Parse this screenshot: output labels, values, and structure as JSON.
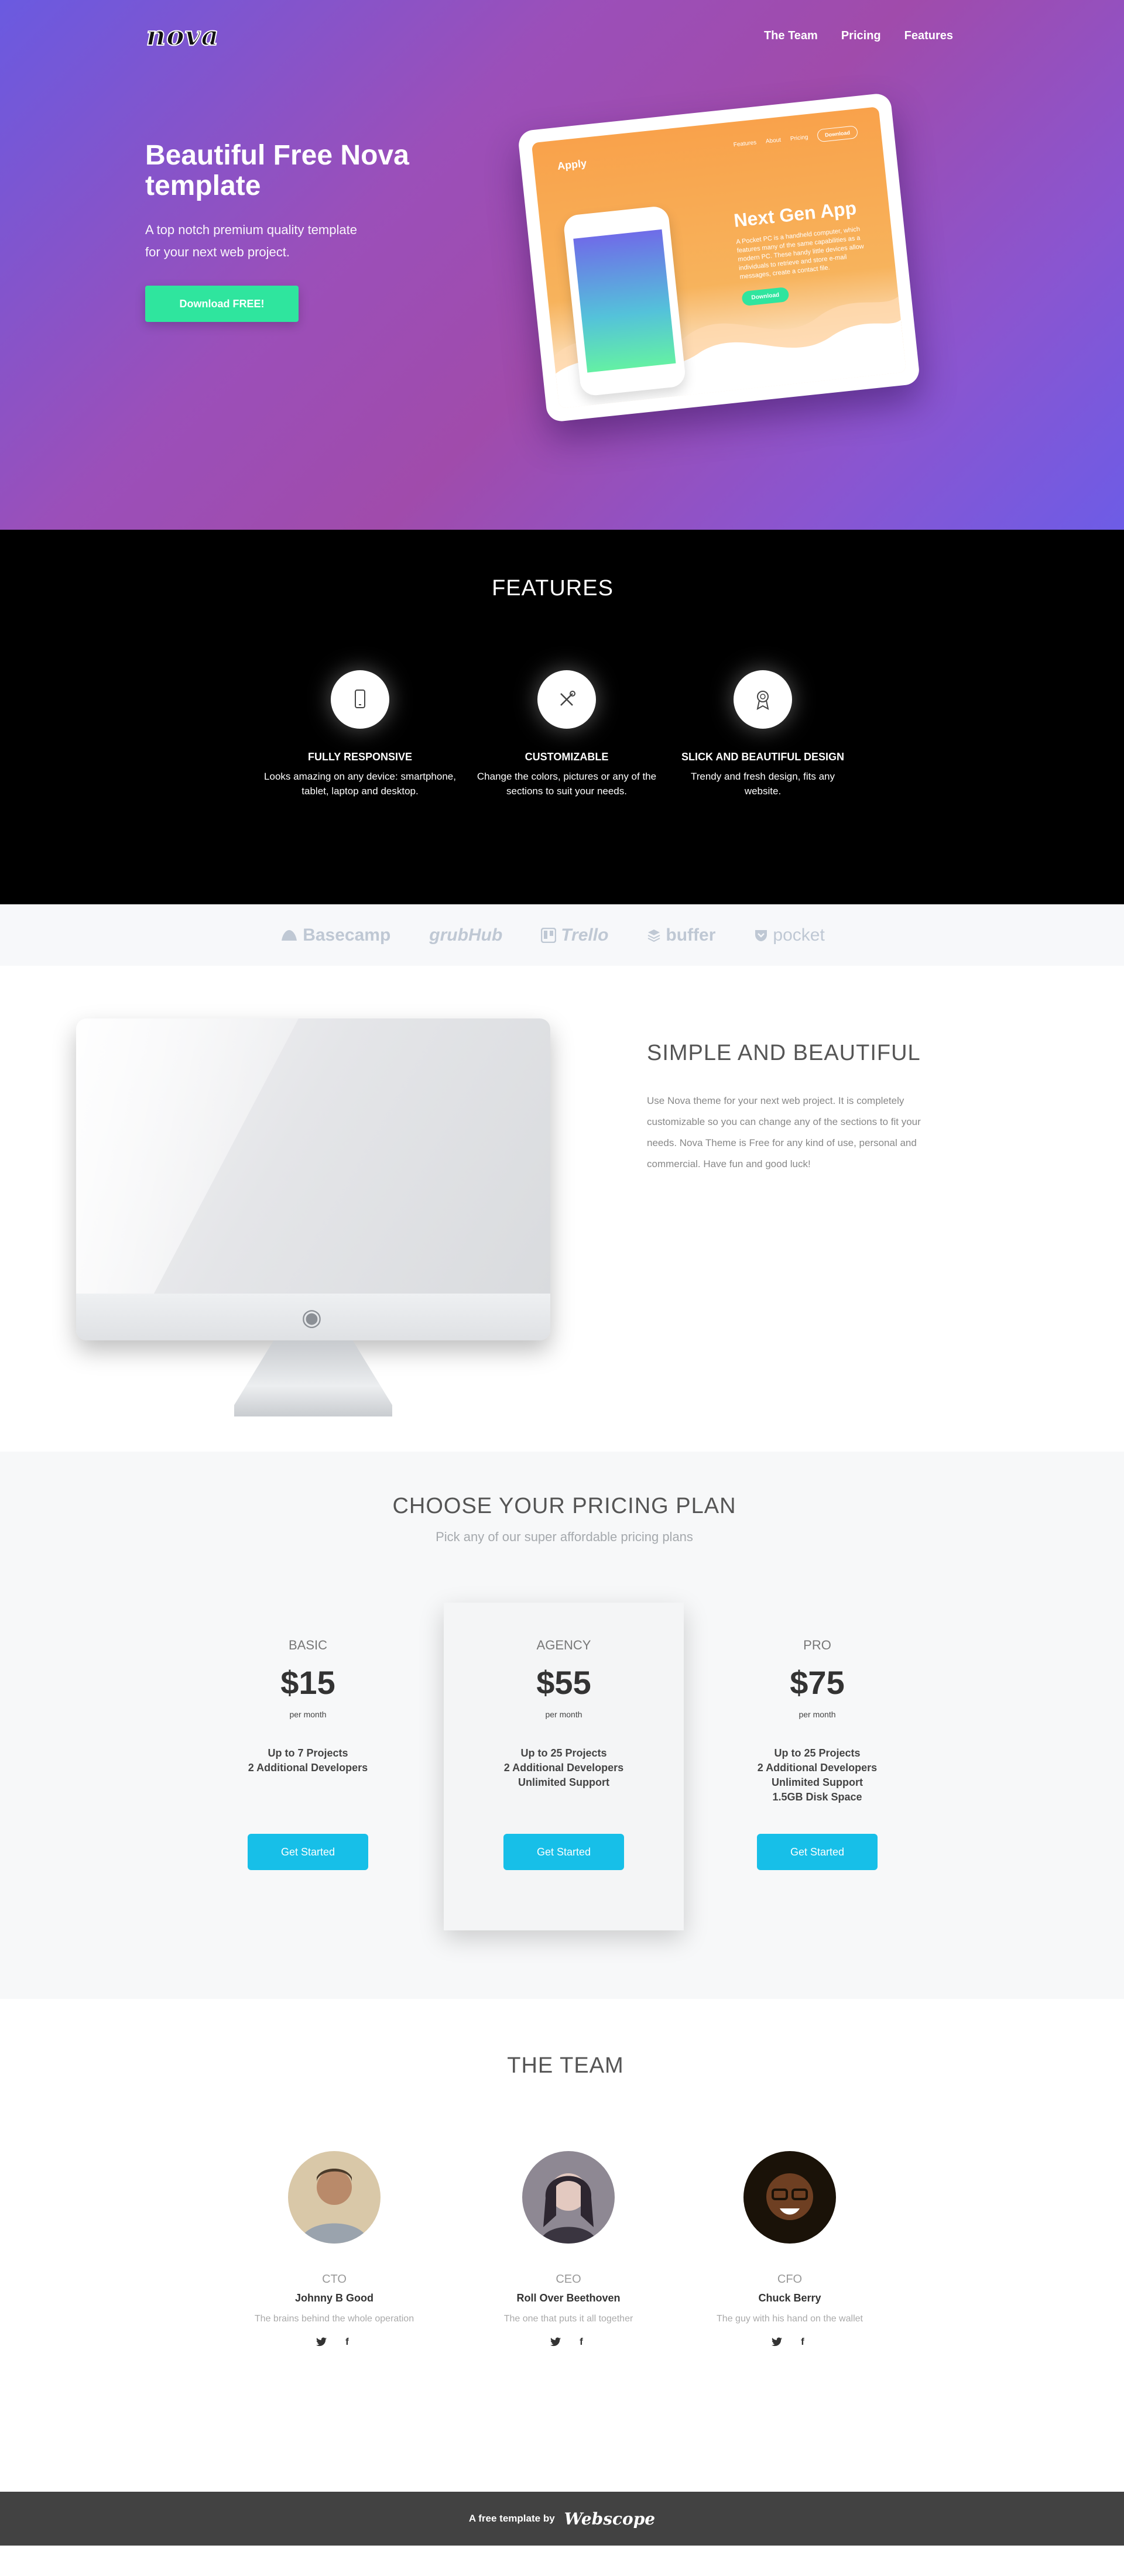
{
  "nav": {
    "logo": "nova",
    "links": [
      "The Team",
      "Pricing",
      "Features"
    ]
  },
  "hero": {
    "title": "Beautiful Free Nova template",
    "text": "A top notch premium quality template for your next web project.",
    "button": "Download FREE!",
    "mockup": {
      "brand": "Apply",
      "links": [
        "Features",
        "About",
        "Pricing",
        "Download"
      ],
      "title": "Next Gen App",
      "text": "A Pocket PC is a handheld computer, which features many of the same capabilities as a modern PC. These handy little devices allow individuals to retrieve and store e-mail messages, create a contact file.",
      "button": "Download"
    }
  },
  "features": {
    "title": "FEATURES",
    "items": [
      {
        "icon": "mobile-phone-icon",
        "title": "FULLY RESPONSIVE",
        "text": "Looks amazing on any device: smartphone, tablet, laptop and desktop."
      },
      {
        "icon": "wrench-tools-icon",
        "title": "CUSTOMIZABLE",
        "text": "Change the colors, pictures or any of the sections to suit your needs."
      },
      {
        "icon": "award-ribbon-icon",
        "title": "SLICK AND BEAUTIFUL DESIGN",
        "text": "Trendy and fresh design, fits any website."
      }
    ]
  },
  "clients": [
    "Basecamp",
    "grubHub",
    "Trello",
    "buffer",
    "pocket"
  ],
  "about": {
    "title": "SIMPLE AND BEAUTIFUL",
    "text": "Use Nova theme for your next web project. It is completely customizable so you can change any of the sections to fit your needs. Nova Theme is Free for any kind of use, personal and commercial. Have fun and good luck!"
  },
  "pricing": {
    "title": "CHOOSE YOUR PRICING PLAN",
    "subtitle": "Pick any of our super affordable pricing plans",
    "plans": [
      {
        "name": "BASIC",
        "price": "$15",
        "period": "per month",
        "features": [
          "Up to 7 Projects",
          "2 Additional Developers"
        ],
        "button": "Get Started"
      },
      {
        "name": "AGENCY",
        "price": "$55",
        "period": "per month",
        "features": [
          "Up to 25 Projects",
          "2 Additional Developers",
          "Unlimited Support"
        ],
        "button": "Get Started"
      },
      {
        "name": "PRO",
        "price": "$75",
        "period": "per month",
        "features": [
          "Up to 25 Projects",
          "2 Additional Developers",
          "Unlimited Support",
          "1.5GB Disk Space"
        ],
        "button": "Get Started"
      }
    ]
  },
  "team": {
    "title": "THE TEAM",
    "members": [
      {
        "role": "CTO",
        "name": "Johnny B Good",
        "bio": "The brains behind the whole operation"
      },
      {
        "role": "CEO",
        "name": "Roll Over Beethoven",
        "bio": "The one that puts it all together"
      },
      {
        "role": "CFO",
        "name": "Chuck Berry",
        "bio": "The guy with his hand on the wallet"
      }
    ]
  },
  "footer": {
    "text": "A free template by",
    "brand": "Webscope"
  },
  "colors": {
    "accent_green": "#2fe59e",
    "accent_blue": "#17bfe8",
    "hero_purple": "#9b4fb9"
  }
}
